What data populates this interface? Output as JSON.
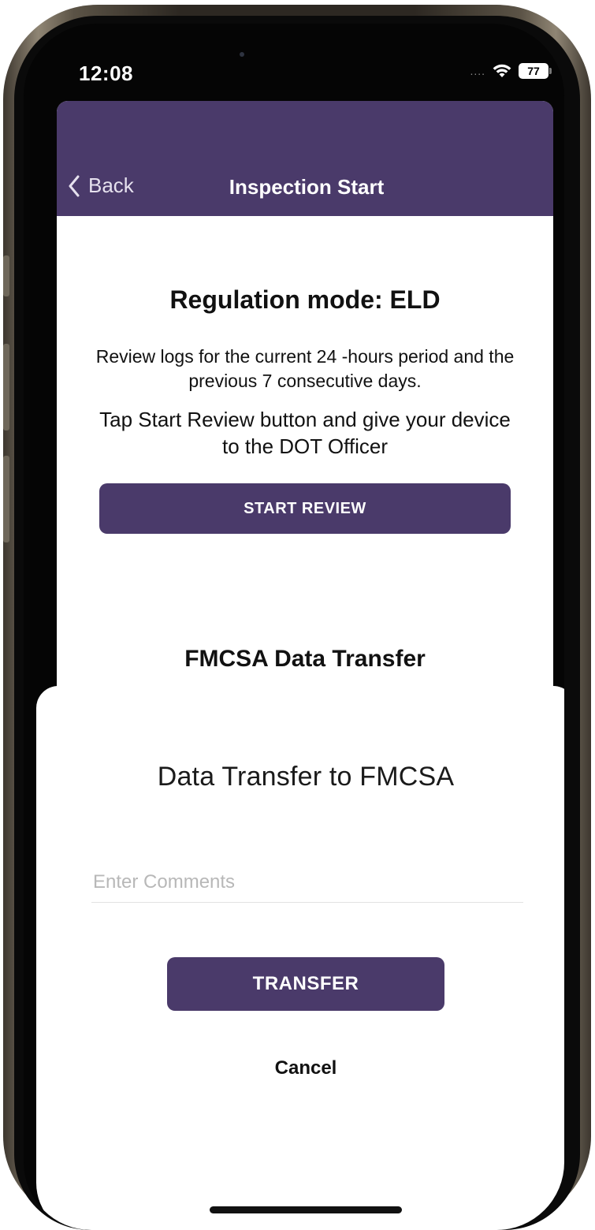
{
  "status_bar": {
    "time": "12:08",
    "signal": "....",
    "battery": "77"
  },
  "nav": {
    "back_label": "Back",
    "title": "Inspection Start"
  },
  "content": {
    "regulation_mode": "Regulation mode: ELD",
    "review_description": "Review logs for the current 24 -hours period and the previous 7 consecutive days.",
    "tap_instruction": "Tap Start Review button and give your device to the DOT Officer",
    "start_review_label": "START REVIEW",
    "fmcsa_heading": "FMCSA Data Transfer"
  },
  "sheet": {
    "title": "Data Transfer to FMCSA",
    "comments_placeholder": "Enter Comments",
    "transfer_label": "TRANSFER",
    "cancel_label": "Cancel"
  },
  "colors": {
    "brand_purple": "#4a3a6a",
    "background": "#ffffff",
    "text": "#111111",
    "placeholder": "#b8b8b8"
  },
  "icons": [
    "chevron-left-icon",
    "wifi-icon",
    "battery-icon"
  ]
}
